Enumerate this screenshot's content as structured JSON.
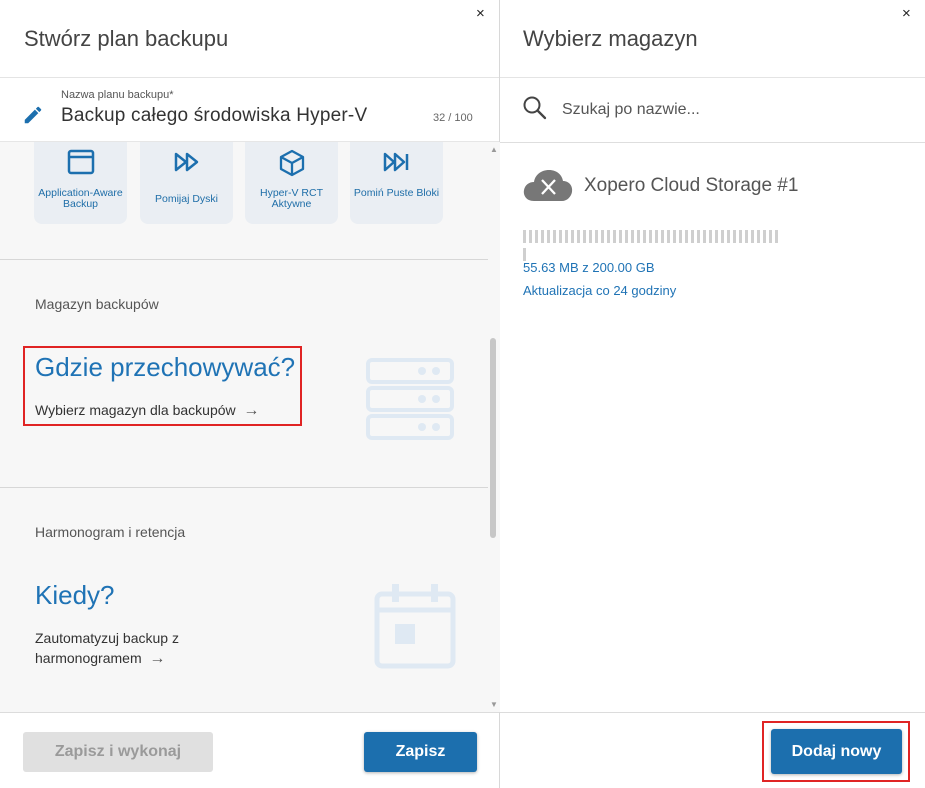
{
  "left_panel": {
    "title": "Stwórz plan backupu",
    "close_glyph": "×",
    "plan_name": {
      "label": "Nazwa planu backupu*",
      "value": "Backup całego środowiska Hyper-V",
      "counter": "32 / 100"
    },
    "features": [
      {
        "icon": "application-window-icon",
        "label": "Application-Aware Backup"
      },
      {
        "icon": "fast-forward-icon",
        "label": "Pomijaj Dyski"
      },
      {
        "icon": "cube-icon",
        "label": "Hyper-V RCT Aktywne"
      },
      {
        "icon": "skip-forward-icon",
        "label": "Pomiń Puste Bloki"
      }
    ],
    "storage_section": {
      "label": "Magazyn backupów",
      "title": "Gdzie przechowywać?",
      "link": "Wybierz magazyn dla backupów",
      "arrow": "→"
    },
    "schedule_section": {
      "label": "Harmonogram i retencja",
      "title": "Kiedy?",
      "link_line1": "Zautomatyzuj backup z",
      "link_line2": "harmonogramem",
      "arrow": "→"
    },
    "footer": {
      "save_run_label": "Zapisz i wykonaj",
      "save_label": "Zapisz"
    }
  },
  "right_panel": {
    "title": "Wybierz magazyn",
    "close_glyph": "×",
    "search": {
      "placeholder": "Szukaj po nazwie..."
    },
    "storage_item": {
      "name": "Xopero Cloud Storage #1",
      "usage": "55.63 MB z 200.00 GB",
      "used_fraction": 0.0003,
      "update": "Aktualizacja co 24 godziny"
    },
    "footer": {
      "add_label": "Dodaj nowy"
    }
  },
  "colors": {
    "accent": "#1c6fae",
    "link": "#1f73b5",
    "highlight": "#e02424",
    "disabled": "#e0e0e0"
  }
}
